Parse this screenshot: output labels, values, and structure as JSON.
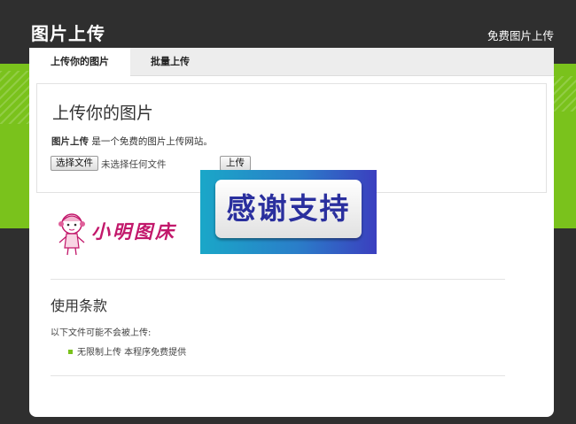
{
  "header": {
    "title": "图片上传",
    "link": "免费图片上传"
  },
  "tabs": [
    {
      "label": "上传你的图片",
      "active": true
    },
    {
      "label": "批量上传",
      "active": false
    }
  ],
  "upload": {
    "title": "上传你的图片",
    "desc_bold": "图片上传",
    "desc_rest": " 是一个免费的图片上传网站。",
    "file_button": "选择文件",
    "file_status": "未选择任何文件",
    "submit_button": "上传"
  },
  "logo": {
    "text": "小明图床"
  },
  "banner": {
    "text": "感谢支持"
  },
  "terms": {
    "title": "使用条款",
    "desc": "以下文件可能不会被上传:",
    "items": [
      "无限制上传 本程序免费提供"
    ]
  },
  "colors": {
    "accent_green": "#7ac21c",
    "dark_bg": "#2f2f2f"
  }
}
